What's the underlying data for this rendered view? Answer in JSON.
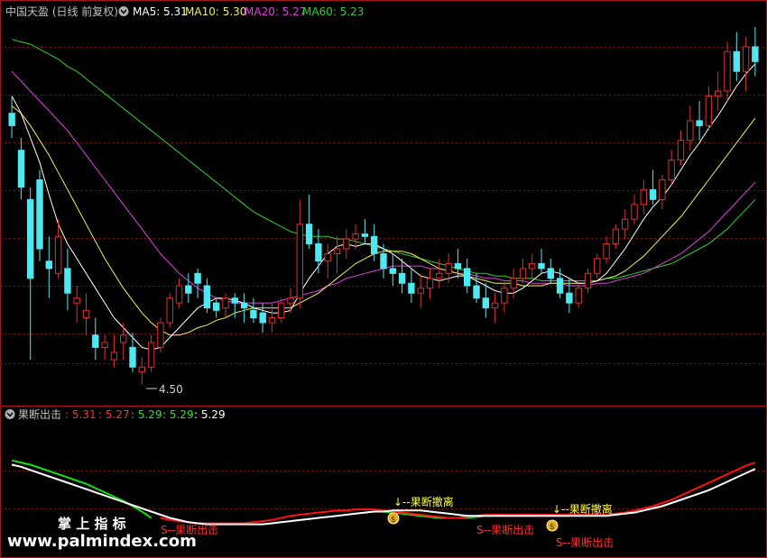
{
  "colors": {
    "background": "#000000",
    "grid": "#8a1010",
    "frame": "#a01818",
    "up": "#e0302a",
    "down": "#50e8f0",
    "ma5": "#ffffff",
    "ma10": "#f0f050",
    "ma20": "#e040e0",
    "ma60": "#30d030",
    "sub_white": "#ffffff",
    "sub_red": "#ff1010",
    "sub_green": "#10e010",
    "signal_yellow": "#ffff40",
    "signal_red": "#ff3030",
    "title_grey": "#c0c0c0",
    "watermark": "#ffffff"
  },
  "main_header": {
    "title": "中国天盈 (日线 前复权)",
    "collapse_icon": "chevron-down-icon",
    "ma5_label": "MA5: 5.31",
    "ma10_label": "MA10: 5.30",
    "ma20_label": "MA20: 5.27",
    "ma60_label": "MA60: 5.23"
  },
  "low_marker": "4.50",
  "sub_header": {
    "title": "果断出击",
    "collapse_icon": "chevron-down-icon",
    "v1": ": 5.31",
    "v2": ": 5.27",
    "v3": ": 5.29",
    "v4": ": 5.29",
    "v5": ": 5.29"
  },
  "signals": [
    {
      "type": "retreat",
      "text": "↓--果断撤离",
      "x": 0.51,
      "icon": "money-bag-icon"
    },
    {
      "type": "retreat",
      "text": "↓--果断撤离",
      "x": 0.72,
      "icon": "money-bag-icon"
    },
    {
      "type": "attack",
      "text": "S--果断出击",
      "x": 0.62
    },
    {
      "type": "attack",
      "text": "S--果断出击",
      "x": 0.73
    },
    {
      "type": "attack",
      "text": "S--果断出击",
      "x": 0.215
    }
  ],
  "watermark": {
    "line1": "掌 上 指 标",
    "line2": "www.palmindex.com"
  },
  "chart_data": {
    "type": "candlestick",
    "ylim": [
      4.4,
      5.9
    ],
    "sub_ylim": [
      4.8,
      5.9
    ],
    "candles": [
      [
        5.55,
        5.62,
        5.45,
        5.5
      ],
      [
        5.4,
        5.45,
        5.2,
        5.25
      ],
      [
        5.2,
        5.25,
        4.55,
        4.88
      ],
      [
        5.28,
        5.32,
        4.95,
        5.0
      ],
      [
        4.95,
        5.05,
        4.8,
        4.92
      ],
      [
        4.9,
        5.12,
        4.88,
        5.05
      ],
      [
        4.92,
        5.0,
        4.75,
        4.82
      ],
      [
        4.78,
        4.85,
        4.7,
        4.8
      ],
      [
        4.72,
        4.82,
        4.65,
        4.75
      ],
      [
        4.65,
        4.72,
        4.55,
        4.6
      ],
      [
        4.6,
        4.65,
        4.55,
        4.62
      ],
      [
        4.55,
        4.65,
        4.52,
        4.58
      ],
      [
        4.62,
        4.7,
        4.55,
        4.65
      ],
      [
        4.6,
        4.66,
        4.5,
        4.52
      ],
      [
        4.5,
        4.56,
        4.45,
        4.52
      ],
      [
        4.52,
        4.65,
        4.5,
        4.62
      ],
      [
        4.6,
        4.72,
        4.58,
        4.7
      ],
      [
        4.7,
        4.82,
        4.68,
        4.8
      ],
      [
        4.78,
        4.88,
        4.76,
        4.85
      ],
      [
        4.85,
        4.9,
        4.78,
        4.82
      ],
      [
        4.9,
        4.92,
        4.8,
        4.86
      ],
      [
        4.85,
        4.88,
        4.74,
        4.76
      ],
      [
        4.78,
        4.8,
        4.72,
        4.75
      ],
      [
        4.76,
        4.82,
        4.72,
        4.8
      ],
      [
        4.8,
        4.82,
        4.72,
        4.78
      ],
      [
        4.78,
        4.82,
        4.7,
        4.76
      ],
      [
        4.75,
        4.8,
        4.7,
        4.72
      ],
      [
        4.74,
        4.78,
        4.66,
        4.7
      ],
      [
        4.7,
        4.78,
        4.66,
        4.72
      ],
      [
        4.72,
        4.8,
        4.7,
        4.78
      ],
      [
        4.78,
        4.84,
        4.74,
        4.8
      ],
      [
        4.8,
        5.2,
        4.76,
        5.1
      ],
      [
        5.1,
        5.22,
        5.0,
        5.02
      ],
      [
        5.02,
        5.08,
        4.9,
        4.95
      ],
      [
        4.95,
        5.02,
        4.88,
        4.98
      ],
      [
        4.98,
        5.05,
        4.9,
        5.0
      ],
      [
        5.0,
        5.08,
        4.96,
        5.04
      ],
      [
        5.04,
        5.1,
        5.0,
        5.06
      ],
      [
        5.06,
        5.12,
        5.02,
        5.05
      ],
      [
        5.05,
        5.1,
        4.95,
        4.98
      ],
      [
        4.98,
        5.02,
        4.88,
        4.92
      ],
      [
        4.92,
        4.98,
        4.85,
        4.9
      ],
      [
        4.9,
        4.96,
        4.82,
        4.86
      ],
      [
        4.86,
        4.92,
        4.78,
        4.82
      ],
      [
        4.82,
        4.9,
        4.76,
        4.84
      ],
      [
        4.84,
        4.92,
        4.8,
        4.88
      ],
      [
        4.88,
        4.96,
        4.84,
        4.9
      ],
      [
        4.9,
        4.98,
        4.86,
        4.94
      ],
      [
        4.94,
        5.0,
        4.88,
        4.92
      ],
      [
        4.92,
        4.96,
        4.82,
        4.85
      ],
      [
        4.85,
        4.9,
        4.78,
        4.8
      ],
      [
        4.8,
        4.86,
        4.72,
        4.76
      ],
      [
        4.76,
        4.82,
        4.7,
        4.78
      ],
      [
        4.78,
        4.86,
        4.74,
        4.84
      ],
      [
        4.84,
        4.92,
        4.8,
        4.88
      ],
      [
        4.88,
        4.96,
        4.86,
        4.92
      ],
      [
        4.92,
        4.98,
        4.88,
        4.94
      ],
      [
        4.94,
        5.0,
        4.9,
        4.92
      ],
      [
        4.92,
        4.96,
        4.86,
        4.88
      ],
      [
        4.88,
        4.92,
        4.8,
        4.82
      ],
      [
        4.82,
        4.88,
        4.74,
        4.78
      ],
      [
        4.78,
        4.86,
        4.76,
        4.84
      ],
      [
        4.84,
        4.92,
        4.82,
        4.9
      ],
      [
        4.9,
        4.98,
        4.88,
        4.96
      ],
      [
        4.96,
        5.05,
        4.94,
        5.02
      ],
      [
        5.02,
        5.1,
        5.0,
        5.08
      ],
      [
        5.08,
        5.16,
        5.04,
        5.12
      ],
      [
        5.12,
        5.22,
        5.1,
        5.18
      ],
      [
        5.18,
        5.28,
        5.14,
        5.24
      ],
      [
        5.24,
        5.32,
        5.18,
        5.2
      ],
      [
        5.2,
        5.3,
        5.16,
        5.28
      ],
      [
        5.28,
        5.4,
        5.26,
        5.36
      ],
      [
        5.36,
        5.48,
        5.34,
        5.44
      ],
      [
        5.44,
        5.58,
        5.4,
        5.52
      ],
      [
        5.52,
        5.6,
        5.44,
        5.5
      ],
      [
        5.5,
        5.66,
        5.48,
        5.62
      ],
      [
        5.62,
        5.72,
        5.56,
        5.64
      ],
      [
        5.64,
        5.84,
        5.6,
        5.8
      ],
      [
        5.8,
        5.88,
        5.68,
        5.72
      ],
      [
        5.72,
        5.86,
        5.64,
        5.82
      ],
      [
        5.82,
        5.9,
        5.7,
        5.76
      ]
    ],
    "ma5": [
      5.62,
      5.55,
      5.45,
      5.35,
      5.22,
      5.1,
      5.02,
      4.96,
      4.9,
      4.84,
      4.78,
      4.72,
      4.68,
      4.64,
      4.6,
      4.59,
      4.6,
      4.64,
      4.68,
      4.72,
      4.76,
      4.78,
      4.8,
      4.8,
      4.79,
      4.78,
      4.76,
      4.75,
      4.74,
      4.74,
      4.75,
      4.82,
      4.88,
      4.93,
      4.98,
      5.01,
      5.02,
      5.01,
      5.02,
      5.02,
      5.0,
      4.98,
      4.95,
      4.92,
      4.89,
      4.88,
      4.87,
      4.88,
      4.89,
      4.89,
      4.87,
      4.85,
      4.83,
      4.82,
      4.82,
      4.84,
      4.87,
      4.9,
      4.91,
      4.9,
      4.88,
      4.86,
      4.86,
      4.87,
      4.9,
      4.95,
      5.0,
      5.06,
      5.12,
      5.17,
      5.21,
      5.26,
      5.32,
      5.38,
      5.43,
      5.49,
      5.54,
      5.6,
      5.66,
      5.71,
      5.75
    ],
    "ma10": [
      5.58,
      5.55,
      5.5,
      5.44,
      5.38,
      5.31,
      5.24,
      5.17,
      5.1,
      5.03,
      4.96,
      4.9,
      4.84,
      4.79,
      4.74,
      4.7,
      4.67,
      4.65,
      4.65,
      4.66,
      4.68,
      4.69,
      4.71,
      4.72,
      4.74,
      4.75,
      4.76,
      4.76,
      4.76,
      4.76,
      4.76,
      4.78,
      4.8,
      4.82,
      4.85,
      4.88,
      4.91,
      4.94,
      4.96,
      4.98,
      4.99,
      4.99,
      4.99,
      4.98,
      4.96,
      4.94,
      4.92,
      4.91,
      4.9,
      4.89,
      4.88,
      4.87,
      4.86,
      4.86,
      4.86,
      4.85,
      4.85,
      4.85,
      4.86,
      4.86,
      4.86,
      4.86,
      4.86,
      4.87,
      4.88,
      4.89,
      4.91,
      4.94,
      4.97,
      5.01,
      5.05,
      5.09,
      5.13,
      5.18,
      5.23,
      5.28,
      5.33,
      5.38,
      5.43,
      5.48,
      5.53
    ],
    "ma20": [
      5.72,
      5.68,
      5.64,
      5.6,
      5.56,
      5.52,
      5.48,
      5.43,
      5.38,
      5.33,
      5.28,
      5.23,
      5.18,
      5.13,
      5.08,
      5.03,
      4.98,
      4.94,
      4.9,
      4.87,
      4.84,
      4.82,
      4.8,
      4.79,
      4.78,
      4.78,
      4.78,
      4.78,
      4.78,
      4.79,
      4.8,
      4.81,
      4.82,
      4.83,
      4.85,
      4.86,
      4.88,
      4.89,
      4.9,
      4.91,
      4.92,
      4.93,
      4.93,
      4.93,
      4.93,
      4.92,
      4.92,
      4.91,
      4.9,
      4.9,
      4.89,
      4.88,
      4.88,
      4.87,
      4.87,
      4.87,
      4.86,
      4.86,
      4.86,
      4.86,
      4.85,
      4.85,
      4.85,
      4.86,
      4.86,
      4.87,
      4.88,
      4.89,
      4.9,
      4.92,
      4.94,
      4.96,
      4.98,
      5.01,
      5.04,
      5.07,
      5.11,
      5.15,
      5.19,
      5.23,
      5.27
    ],
    "ma60": [
      5.85,
      5.84,
      5.83,
      5.81,
      5.79,
      5.77,
      5.74,
      5.72,
      5.69,
      5.66,
      5.63,
      5.6,
      5.57,
      5.54,
      5.51,
      5.48,
      5.45,
      5.42,
      5.39,
      5.36,
      5.33,
      5.3,
      5.27,
      5.24,
      5.21,
      5.18,
      5.15,
      5.13,
      5.11,
      5.09,
      5.07,
      5.06,
      5.05,
      5.05,
      5.05,
      5.04,
      5.04,
      5.03,
      5.02,
      5.01,
      5.0,
      4.99,
      4.98,
      4.97,
      4.96,
      4.95,
      4.94,
      4.93,
      4.92,
      4.91,
      4.9,
      4.9,
      4.89,
      4.89,
      4.88,
      4.88,
      4.88,
      4.87,
      4.87,
      4.87,
      4.87,
      4.87,
      4.87,
      4.87,
      4.88,
      4.88,
      4.89,
      4.9,
      4.91,
      4.92,
      4.93,
      4.94,
      4.96,
      4.98,
      5.0,
      5.02,
      5.05,
      5.08,
      5.12,
      5.16,
      5.2
    ],
    "sub_white": [
      5.6,
      5.58,
      5.55,
      5.52,
      5.49,
      5.46,
      5.43,
      5.4,
      5.37,
      5.34,
      5.31,
      5.28,
      5.25,
      5.22,
      5.19,
      5.16,
      5.13,
      5.1,
      5.08,
      5.06,
      5.05,
      5.04,
      5.04,
      5.04,
      5.04,
      5.04,
      5.04,
      5.04,
      5.05,
      5.06,
      5.07,
      5.08,
      5.09,
      5.1,
      5.11,
      5.12,
      5.13,
      5.14,
      5.15,
      5.16,
      5.16,
      5.17,
      5.17,
      5.17,
      5.17,
      5.16,
      5.15,
      5.14,
      5.13,
      5.12,
      5.12,
      5.12,
      5.12,
      5.12,
      5.12,
      5.12,
      5.12,
      5.12,
      5.12,
      5.12,
      5.12,
      5.12,
      5.12,
      5.12,
      5.12,
      5.13,
      5.14,
      5.15,
      5.17,
      5.19,
      5.21,
      5.24,
      5.27,
      5.3,
      5.33,
      5.36,
      5.4,
      5.44,
      5.48,
      5.52,
      5.56
    ],
    "sub_red": [
      null,
      null,
      null,
      null,
      null,
      null,
      null,
      null,
      null,
      null,
      null,
      null,
      null,
      null,
      null,
      null,
      5.1,
      5.08,
      5.07,
      5.06,
      5.05,
      5.05,
      5.05,
      5.05,
      5.05,
      5.05,
      5.06,
      5.07,
      5.08,
      5.1,
      5.12,
      5.13,
      5.14,
      5.15,
      5.16,
      5.17,
      5.17,
      5.18,
      5.18,
      5.18,
      5.17,
      5.16,
      5.15,
      5.14,
      5.13,
      5.12,
      5.11,
      5.1,
      5.1,
      5.11,
      5.12,
      5.13,
      5.13,
      5.13,
      5.13,
      5.13,
      5.13,
      5.13,
      5.13,
      5.13,
      5.13,
      5.13,
      5.13,
      5.13,
      5.13,
      5.14,
      5.15,
      5.17,
      5.19,
      5.21,
      5.24,
      5.27,
      5.31,
      5.35,
      5.39,
      5.43,
      5.47,
      5.51,
      5.55,
      5.59,
      5.62
    ],
    "sub_green": [
      5.64,
      5.62,
      5.6,
      5.57,
      5.54,
      5.51,
      5.48,
      5.45,
      5.42,
      5.38,
      5.34,
      5.3,
      5.26,
      5.21,
      5.16,
      5.1,
      null,
      null,
      null,
      null,
      null,
      null,
      null,
      null,
      null,
      null,
      null,
      null,
      null,
      null,
      null,
      null,
      null,
      null,
      null,
      null,
      null,
      null,
      null,
      null,
      5.16,
      5.15,
      5.14,
      5.13,
      5.12,
      5.11,
      5.1,
      5.1,
      5.1,
      5.1,
      5.11,
      5.12,
      5.12,
      5.12,
      5.12,
      5.12,
      5.12,
      5.12,
      5.12,
      5.12,
      5.12,
      null,
      null,
      null,
      null,
      null,
      null,
      null,
      null,
      null,
      null,
      null,
      null,
      null,
      null,
      null,
      null,
      null,
      null,
      null,
      null
    ]
  }
}
